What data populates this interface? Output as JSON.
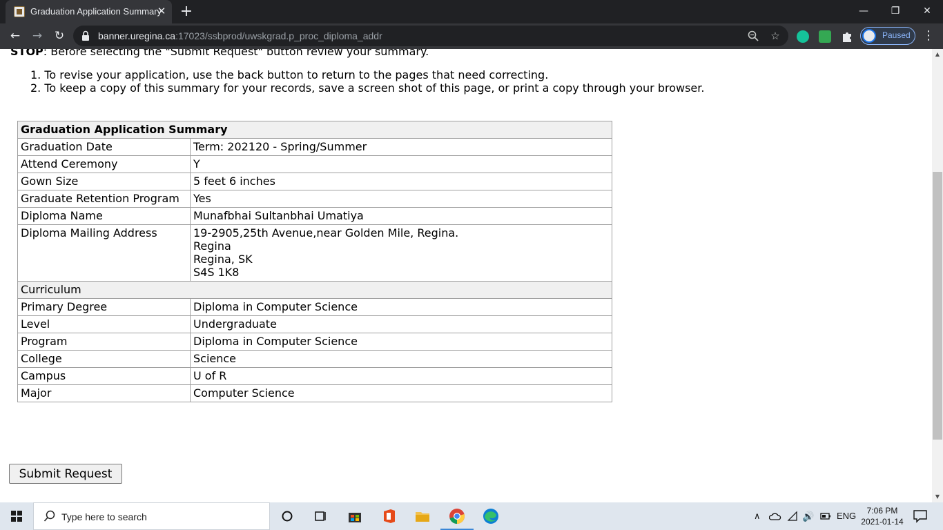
{
  "browser": {
    "tab_title": "Graduation Application Summary",
    "tab_close": "✕",
    "new_tab": "+",
    "url_host": "banner.uregina.ca",
    "url_rest": ":17023/ssbprod/uwskgrad.p_proc_diploma_addr",
    "profile_status": "Paused",
    "window_minimize": "—",
    "window_restore": "❐",
    "window_close": "✕"
  },
  "page": {
    "stop_label": "STOP",
    "stop_text": ": Before selecting the \"Submit Request\" button review your summary.",
    "instructions": [
      "1. To revise your application, use the back button to return to the pages that need correcting.",
      "2. To keep a copy of this summary for your records, save a screen shot of this page, or print a copy through your browser."
    ],
    "summary": {
      "title": "Graduation Application Summary",
      "rows": [
        {
          "label": "Graduation Date",
          "value": "Term: 202120 - Spring/Summer"
        },
        {
          "label": "Attend Ceremony",
          "value": "Y"
        },
        {
          "label": "Gown Size",
          "value": "5 feet 6 inches"
        },
        {
          "label": "Graduate Retention Program",
          "value": "Yes"
        },
        {
          "label": "Diploma Name",
          "value": "Munafbhai Sultanbhai Umatiya"
        }
      ],
      "address": {
        "label": "Diploma Mailing Address",
        "lines": [
          "19-2905,25th Avenue,near Golden Mile, Regina.",
          "Regina",
          "Regina, SK",
          "S4S 1K8"
        ]
      },
      "curriculum_heading": "Curriculum",
      "curriculum_rows": [
        {
          "label": "Primary Degree",
          "value": "Diploma in Computer Science"
        },
        {
          "label": "Level",
          "value": "Undergraduate"
        },
        {
          "label": "Program",
          "value": "Diploma in Computer Science"
        },
        {
          "label": "College",
          "value": "Science"
        },
        {
          "label": "Campus",
          "value": "U of R"
        },
        {
          "label": "Major",
          "value": "Computer Science"
        }
      ]
    },
    "submit_label": "Submit Request"
  },
  "taskbar": {
    "search_placeholder": "Type here to search",
    "language": "ENG",
    "time": "7:06 PM",
    "date": "2021-01-14"
  },
  "colors": {
    "chrome_dark": "#202124",
    "chrome_toolbar": "#35363a",
    "table_header_bg": "#f0f0f0",
    "taskbar_bg": "#dfe6ee"
  }
}
